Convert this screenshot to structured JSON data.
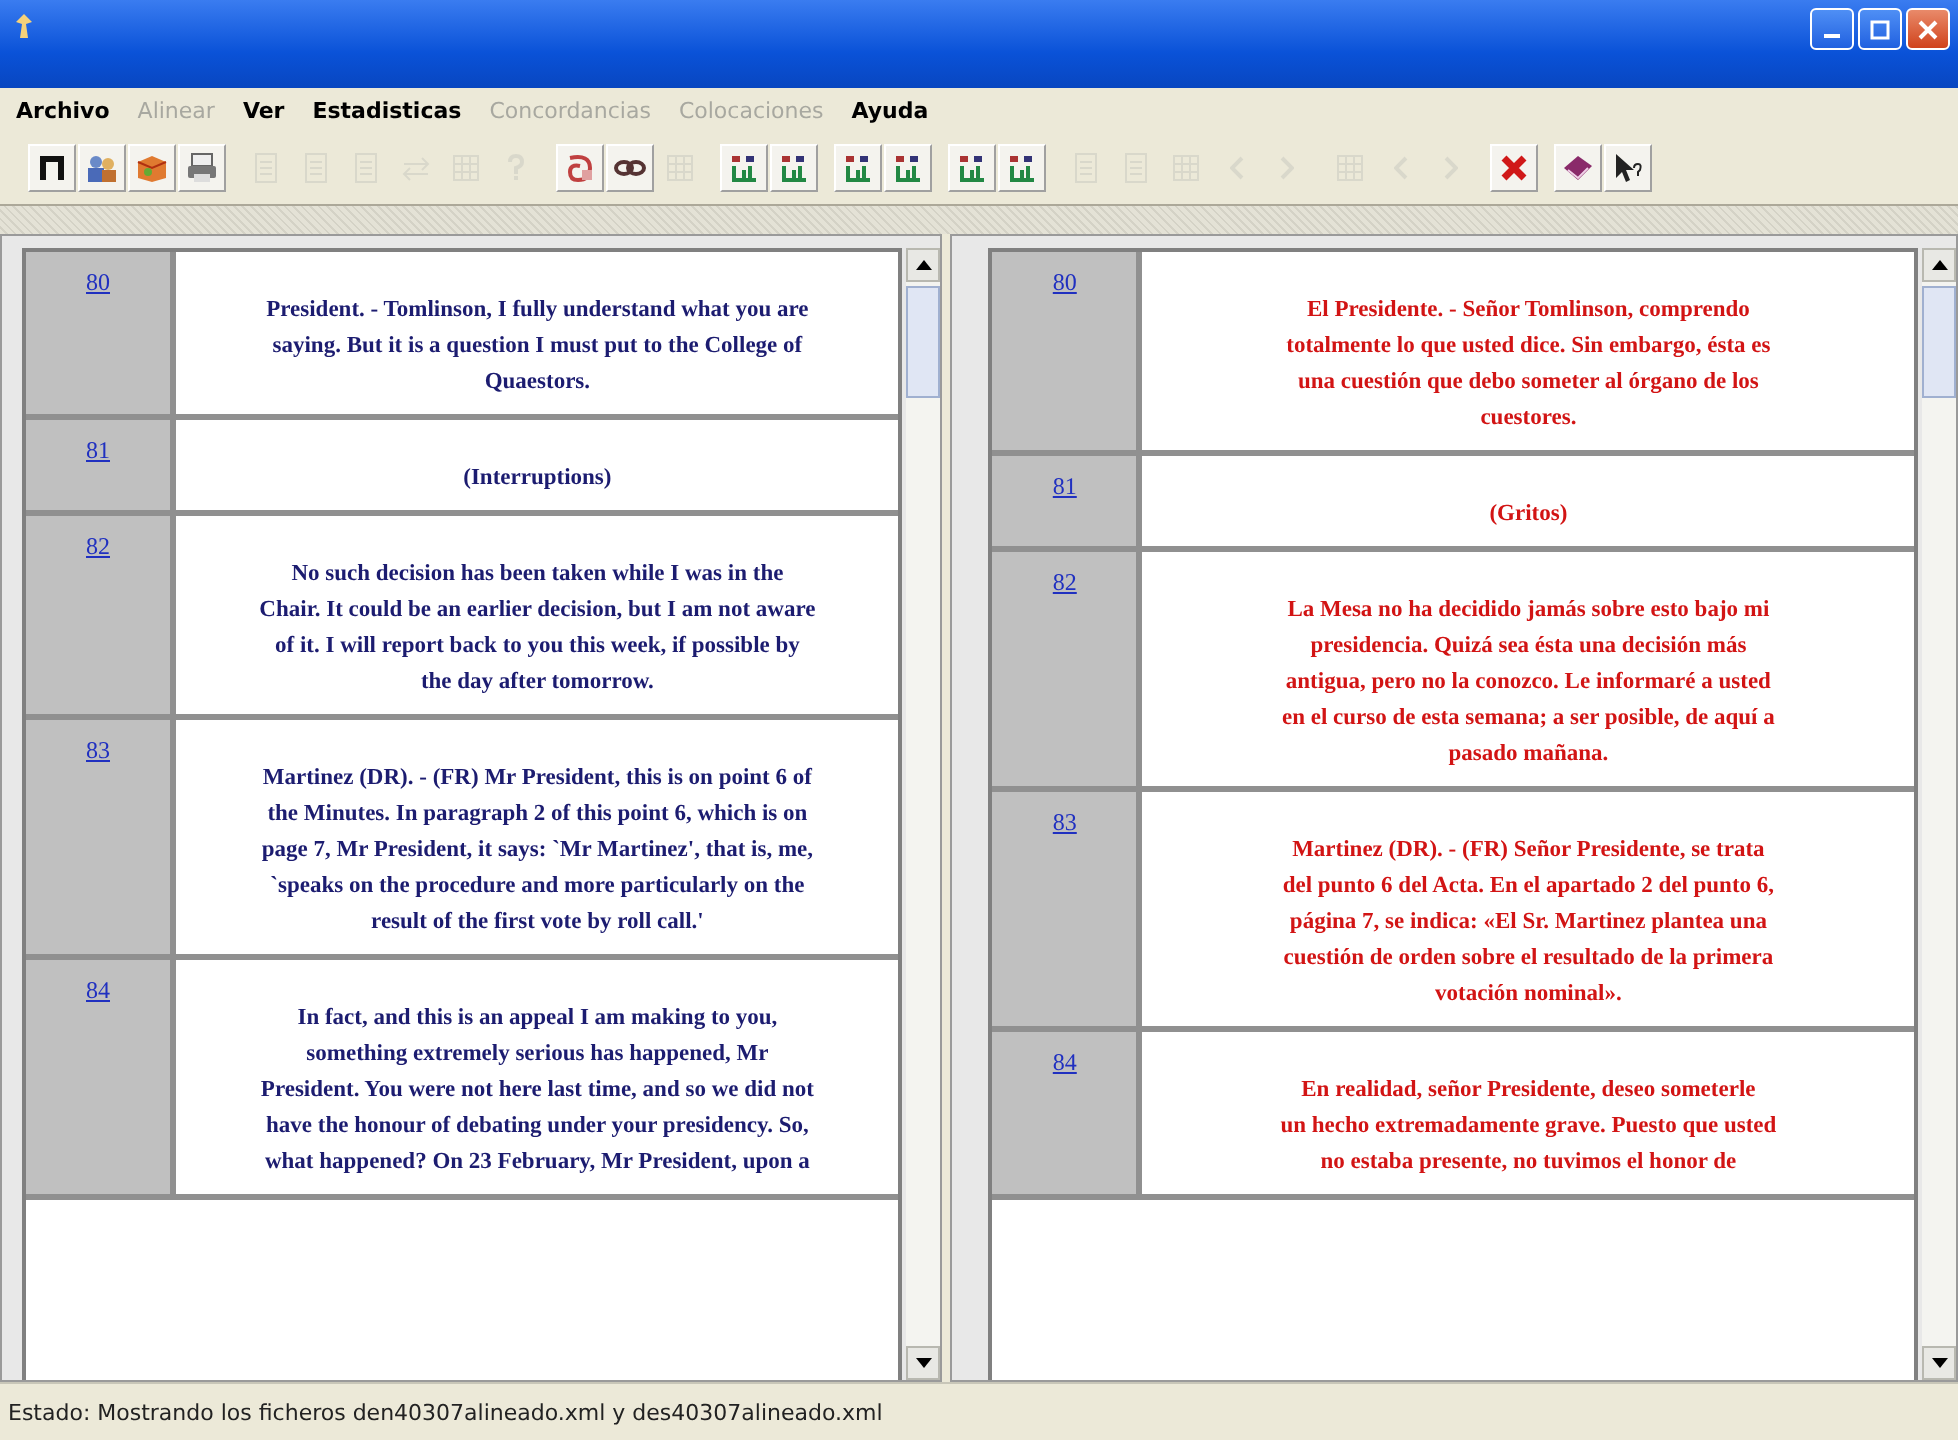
{
  "menu": [
    {
      "label": "Archivo",
      "disabled": false
    },
    {
      "label": "Alinear",
      "disabled": true
    },
    {
      "label": "Ver",
      "disabled": false
    },
    {
      "label": "Estadisticas",
      "disabled": false
    },
    {
      "label": "Concordancias",
      "disabled": true
    },
    {
      "label": "Colocaciones",
      "disabled": true
    },
    {
      "label": "Ayuda",
      "disabled": false
    }
  ],
  "toolbar": [
    [
      {
        "kind": "pi",
        "disabled": false
      },
      {
        "kind": "people",
        "disabled": false
      },
      {
        "kind": "box",
        "disabled": false
      },
      {
        "kind": "printer",
        "disabled": false
      }
    ],
    [
      {
        "kind": "page",
        "disabled": true
      },
      {
        "kind": "page",
        "disabled": true
      },
      {
        "kind": "page",
        "disabled": true
      },
      {
        "kind": "arrows",
        "disabled": true
      },
      {
        "kind": "grid",
        "disabled": true
      },
      {
        "kind": "question",
        "disabled": true
      }
    ],
    [
      {
        "kind": "swirl",
        "disabled": false
      },
      {
        "kind": "link",
        "disabled": false
      },
      {
        "kind": "grid",
        "disabled": true
      }
    ],
    [
      {
        "kind": "chart",
        "disabled": false
      },
      {
        "kind": "chart",
        "disabled": false
      }
    ],
    [
      {
        "kind": "chart",
        "disabled": false
      },
      {
        "kind": "chart",
        "disabled": false
      }
    ],
    [
      {
        "kind": "chart",
        "disabled": false
      },
      {
        "kind": "chart",
        "disabled": false
      }
    ],
    [
      {
        "kind": "page",
        "disabled": true
      },
      {
        "kind": "page",
        "disabled": true
      },
      {
        "kind": "grid",
        "disabled": true
      },
      {
        "kind": "left",
        "disabled": true
      },
      {
        "kind": "right",
        "disabled": true
      }
    ],
    [
      {
        "kind": "grid",
        "disabled": true
      },
      {
        "kind": "left",
        "disabled": true
      },
      {
        "kind": "right",
        "disabled": true
      }
    ],
    [
      {
        "kind": "cross",
        "disabled": false
      }
    ],
    [
      {
        "kind": "book",
        "disabled": false
      },
      {
        "kind": "pointer",
        "disabled": false
      }
    ]
  ],
  "panes": [
    {
      "color": "#1c1c70",
      "rows": [
        {
          "number": "80",
          "lines": [
            "President. - Tomlinson, I fully understand what you are",
            "saying. But it is a question I must put to the College of",
            "Quaestors."
          ]
        },
        {
          "number": "81",
          "lines": [
            "(Interruptions)"
          ]
        },
        {
          "number": "82",
          "lines": [
            "No such decision has been taken while I was in the",
            "Chair. It could be an earlier decision, but I am not aware",
            "of it. I will report back to you this week, if possible by",
            "the day after tomorrow."
          ]
        },
        {
          "number": "83",
          "lines": [
            "Martinez (DR). - (FR) Mr President, this is on point 6 of",
            "the Minutes. In paragraph 2 of this point 6, which is on",
            "page 7, Mr President, it says: `Mr Martinez', that is, me,",
            "`speaks on the procedure and more particularly on the",
            "result of the first vote by roll call.'"
          ]
        },
        {
          "number": "84",
          "lines": [
            "In fact, and this is an appeal I am making to you,",
            "something extremely serious has happened, Mr",
            "President. You were not here last time, and so we did not",
            "have the honour of debating under your presidency. So,",
            "what happened? On 23 February, Mr President, upon a"
          ]
        }
      ]
    },
    {
      "color": "#d21414",
      "rows": [
        {
          "number": "80",
          "lines": [
            "El Presidente. - Señor Tomlinson, comprendo",
            "totalmente lo que usted dice. Sin embargo, ésta es",
            "una cuestión que debo someter al órgano de los",
            "cuestores."
          ]
        },
        {
          "number": "81",
          "lines": [
            "(Gritos)"
          ]
        },
        {
          "number": "82",
          "lines": [
            "La Mesa no ha decidido jamás sobre esto bajo mi",
            "presidencia. Quizá sea ésta una decisión más",
            "antigua, pero no la conozco. Le informaré a usted",
            "en el curso de esta semana; a ser posible, de aquí a",
            "pasado mañana."
          ]
        },
        {
          "number": "83",
          "lines": [
            "Martinez (DR). - (FR) Señor Presidente, se trata",
            "del punto 6 del Acta. En el apartado 2 del punto 6,",
            "página 7, se indica: «El Sr. Martinez plantea una",
            "cuestión de orden sobre el resultado de la primera",
            "votación nominal»."
          ]
        },
        {
          "number": "84",
          "lines": [
            "En realidad, señor Presidente, deseo someterle",
            "un hecho extremadamente grave. Puesto que usted",
            "no estaba presente, no tuvimos el honor de"
          ]
        }
      ]
    }
  ],
  "status_bar": "Estado: Mostrando los ficheros den40307alineado.xml y des40307alineado.xml"
}
